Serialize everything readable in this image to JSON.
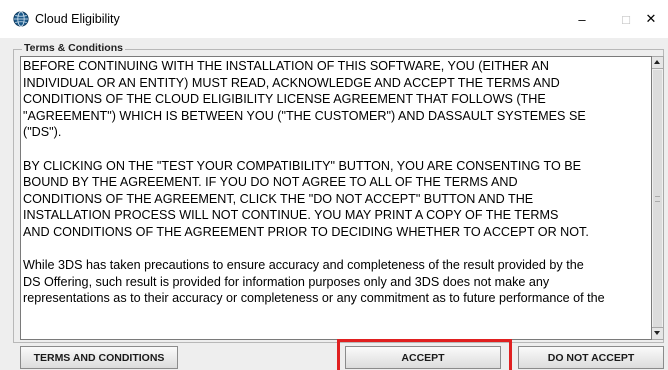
{
  "window": {
    "title": "Cloud Eligibility",
    "minimize_glyph": "–",
    "maximize_glyph": "□",
    "close_glyph": "✕",
    "icon": "globe-icon"
  },
  "group": {
    "title": "Terms & Conditions"
  },
  "terms": {
    "paragraphs": [
      "BEFORE CONTINUING WITH THE INSTALLATION OF THIS SOFTWARE, YOU (EITHER AN\nINDIVIDUAL OR AN ENTITY) MUST READ, ACKNOWLEDGE AND ACCEPT THE TERMS AND\nCONDITIONS OF THE CLOUD ELIGIBILITY LICENSE AGREEMENT THAT FOLLOWS (THE\n\"AGREEMENT\") WHICH IS BETWEEN YOU (\"THE CUSTOMER\") AND DASSAULT SYSTEMES SE\n(\"DS\").",
      "BY CLICKING ON THE \"TEST YOUR COMPATIBILITY\" BUTTON, YOU ARE CONSENTING TO BE\nBOUND BY THE AGREEMENT. IF YOU DO NOT AGREE TO ALL OF THE TERMS AND\nCONDITIONS OF THE AGREEMENT, CLICK THE \"DO NOT ACCEPT\" BUTTON AND THE\nINSTALLATION PROCESS WILL NOT CONTINUE.  YOU MAY PRINT A COPY OF THE TERMS\nAND CONDITIONS OF THE AGREEMENT PRIOR TO DECIDING WHETHER TO ACCEPT OR NOT.",
      "While 3DS has taken precautions to ensure accuracy and completeness of the result provided by the\nDS Offering, such result is provided for information purposes only and 3DS does not make any\nrepresentations as to their accuracy or completeness or any commitment as to future performance of the"
    ]
  },
  "buttons": {
    "terms": "TERMS AND CONDITIONS",
    "accept": "ACCEPT",
    "not_accept": "DO NOT ACCEPT"
  },
  "colors": {
    "highlight": "#e02020",
    "panel": "#eeeeee"
  }
}
